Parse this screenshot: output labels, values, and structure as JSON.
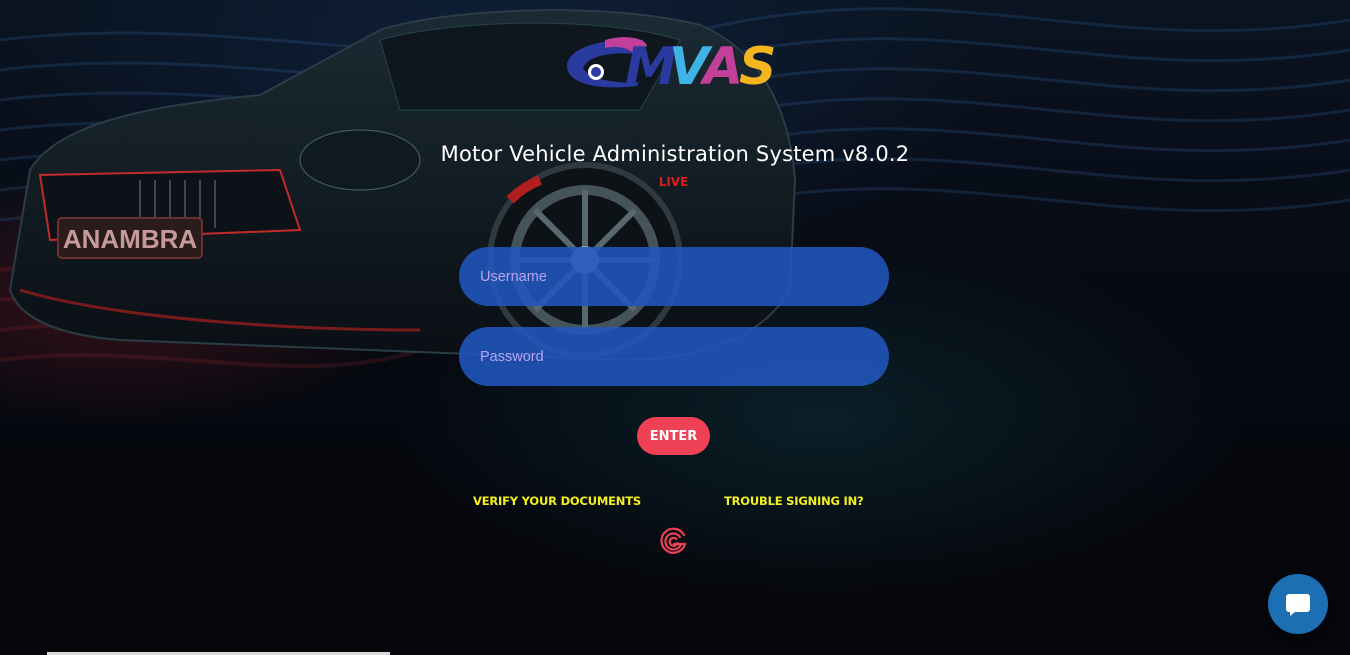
{
  "logo": {
    "text": "MVAS",
    "letters": [
      "M",
      "V",
      "A",
      "S"
    ]
  },
  "header": {
    "title": "Motor Vehicle Administration System v8.0.2",
    "environment": "LIVE"
  },
  "form": {
    "username_placeholder": "Username",
    "username_value": "",
    "password_placeholder": "Password",
    "password_value": "",
    "enter_label": "ENTER"
  },
  "links": {
    "verify": "VERIFY YOUR DOCUMENTS",
    "trouble": "TROUBLE SIGNING IN?"
  },
  "car": {
    "plate_text": "ANAMBRA"
  },
  "icons": {
    "brand": "g-spiral-icon",
    "chat": "chat-bubble-icon"
  },
  "colors": {
    "field_bg": "#2056be",
    "placeholder": "#b9a4f0",
    "enter_bg": "#ee4156",
    "link": "#f4f01e",
    "live": "#e01b1b",
    "chat_bg": "#1d6fb4",
    "logo_m": "#2b3a9e",
    "logo_v": "#3fb3e6",
    "logo_a": "#c23f9a",
    "logo_s": "#f4b51e"
  }
}
